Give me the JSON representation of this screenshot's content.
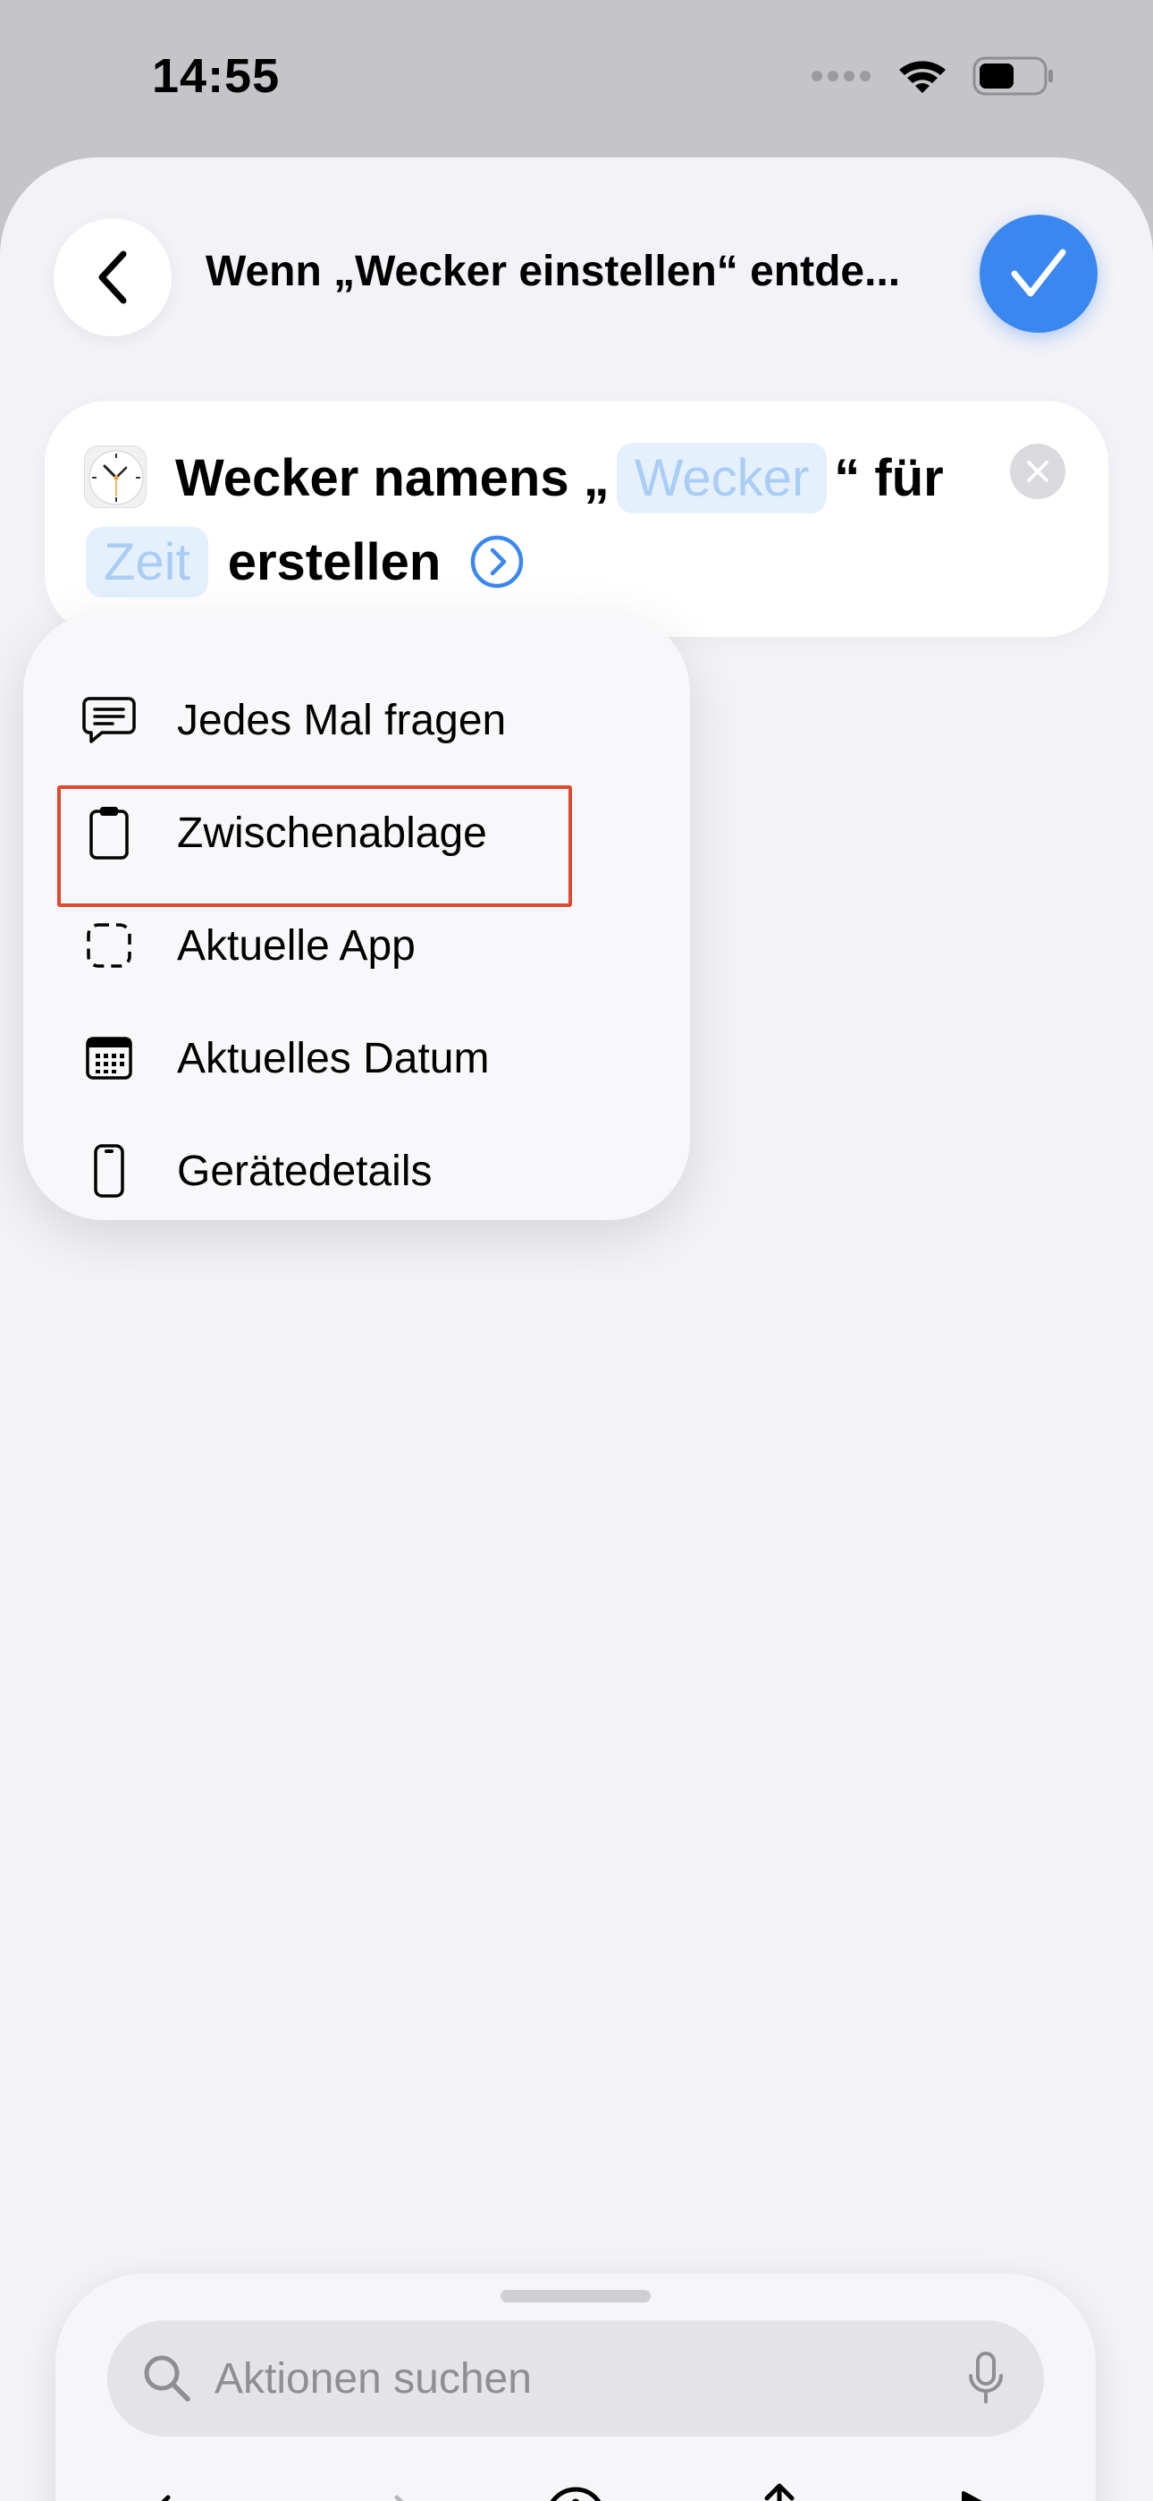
{
  "status_bar": {
    "time": "14:55"
  },
  "header": {
    "title": "Wenn „Wecker einstellen“ entde..."
  },
  "action": {
    "line1_prefix": "Wecker namens „",
    "name_token": "Wecker",
    "line1_suffix": "“ für",
    "time_token": "Zeit",
    "line2_suffix": "erstellen"
  },
  "menu": {
    "items": [
      {
        "label": "Jedes Mal fragen",
        "icon": "speech-bubble-icon"
      },
      {
        "label": "Zwischenablage",
        "icon": "clipboard-icon"
      },
      {
        "label": "Aktuelle App",
        "icon": "dashed-square-icon"
      },
      {
        "label": "Aktuelles Datum",
        "icon": "calendar-icon"
      },
      {
        "label": "Gerätedetails",
        "icon": "phone-icon"
      }
    ]
  },
  "toolbar": {
    "search_placeholder": "Aktionen suchen"
  },
  "colors": {
    "accent": "#3b87f0",
    "highlight": "#e0482f",
    "token_bg": "#e5f0fd",
    "token_text": "#a9cdf5"
  }
}
